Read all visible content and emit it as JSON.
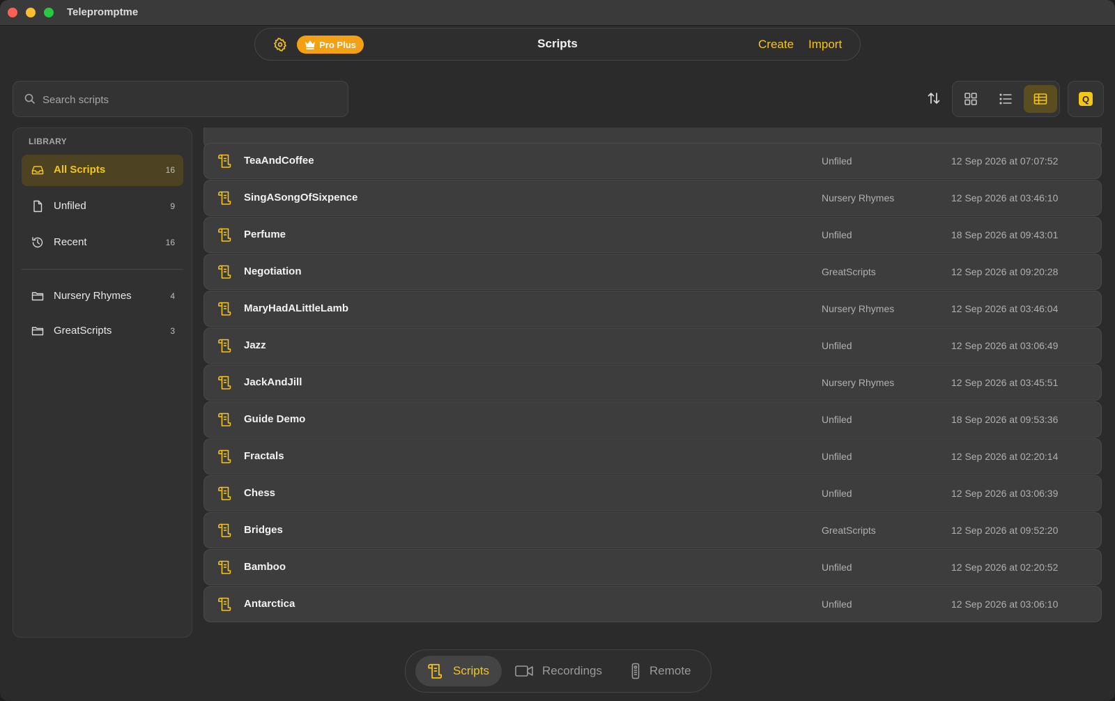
{
  "app": {
    "title": "Telepromptme"
  },
  "toolbar": {
    "badge": "Pro Plus",
    "title": "Scripts",
    "create": "Create",
    "import": "Import"
  },
  "search": {
    "placeholder": "Search scripts",
    "value": ""
  },
  "quick_button": "Q",
  "sidebar": {
    "section_label": "LIBRARY",
    "items": [
      {
        "label": "All Scripts",
        "count": "16",
        "icon": "inbox-icon",
        "active": true
      },
      {
        "label": "Unfiled",
        "count": "9",
        "icon": "document-icon"
      },
      {
        "label": "Recent",
        "count": "16",
        "icon": "history-icon"
      }
    ],
    "folders": [
      {
        "label": "Nursery Rhymes",
        "count": "4",
        "icon": "folder-icon"
      },
      {
        "label": "GreatScripts",
        "count": "3",
        "icon": "folder-icon"
      }
    ]
  },
  "scripts": [
    {
      "name": "TeaAndCoffee",
      "folder": "Unfiled",
      "date": "12 Sep 2026 at 07:07:52"
    },
    {
      "name": "SingASongOfSixpence",
      "folder": "Nursery Rhymes",
      "date": "12 Sep 2026 at 03:46:10"
    },
    {
      "name": "Perfume",
      "folder": "Unfiled",
      "date": "18 Sep 2026 at 09:43:01"
    },
    {
      "name": "Negotiation",
      "folder": "GreatScripts",
      "date": "12 Sep 2026 at 09:20:28"
    },
    {
      "name": "MaryHadALittleLamb",
      "folder": "Nursery Rhymes",
      "date": "12 Sep 2026 at 03:46:04"
    },
    {
      "name": "Jazz",
      "folder": "Unfiled",
      "date": "12 Sep 2026 at 03:06:49"
    },
    {
      "name": "JackAndJill",
      "folder": "Nursery Rhymes",
      "date": "12 Sep 2026 at 03:45:51"
    },
    {
      "name": "Guide Demo",
      "folder": "Unfiled",
      "date": "18 Sep 2026 at 09:53:36"
    },
    {
      "name": "Fractals",
      "folder": "Unfiled",
      "date": "12 Sep 2026 at 02:20:14"
    },
    {
      "name": "Chess",
      "folder": "Unfiled",
      "date": "12 Sep 2026 at 03:06:39"
    },
    {
      "name": "Bridges",
      "folder": "GreatScripts",
      "date": "12 Sep 2026 at 09:52:20"
    },
    {
      "name": "Bamboo",
      "folder": "Unfiled",
      "date": "12 Sep 2026 at 02:20:52"
    },
    {
      "name": "Antarctica",
      "folder": "Unfiled",
      "date": "12 Sep 2026 at 03:06:10"
    }
  ],
  "tabs": [
    {
      "label": "Scripts",
      "icon": "scroll-icon",
      "active": true
    },
    {
      "label": "Recordings",
      "icon": "video-camera-icon"
    },
    {
      "label": "Remote",
      "icon": "remote-icon"
    }
  ],
  "colors": {
    "accent": "#f5c518",
    "badge": "#f4a014",
    "background": "#2b2b2b"
  }
}
